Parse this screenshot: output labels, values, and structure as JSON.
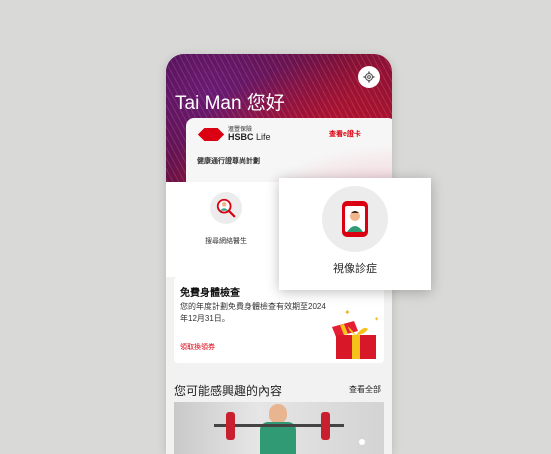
{
  "header": {
    "greeting": "Tai Man 您好"
  },
  "card": {
    "logo_cn": "滙豐保險",
    "logo_en_bold": "HSBC",
    "logo_en_light": "Life",
    "link": "查看e證卡",
    "plan": "健康通行證尊尚計劃"
  },
  "services": [
    {
      "label": "搜尋網絡醫生",
      "icon": "doctor-search-icon"
    }
  ],
  "popup": {
    "label": "視像診症",
    "icon": "video-consultation-icon"
  },
  "offer": {
    "title": "免費身體檢查",
    "body": "您的年度計劃免費身體檢查有效期至2024年12月31日。",
    "link": "領取換領券",
    "icon": "gift-box-icon"
  },
  "recommend": {
    "title": "您可能感興趣的內容",
    "see_all": "查看全部"
  },
  "colors": {
    "brand_red": "#db0011",
    "hero_dark": "#3e0b3f"
  }
}
